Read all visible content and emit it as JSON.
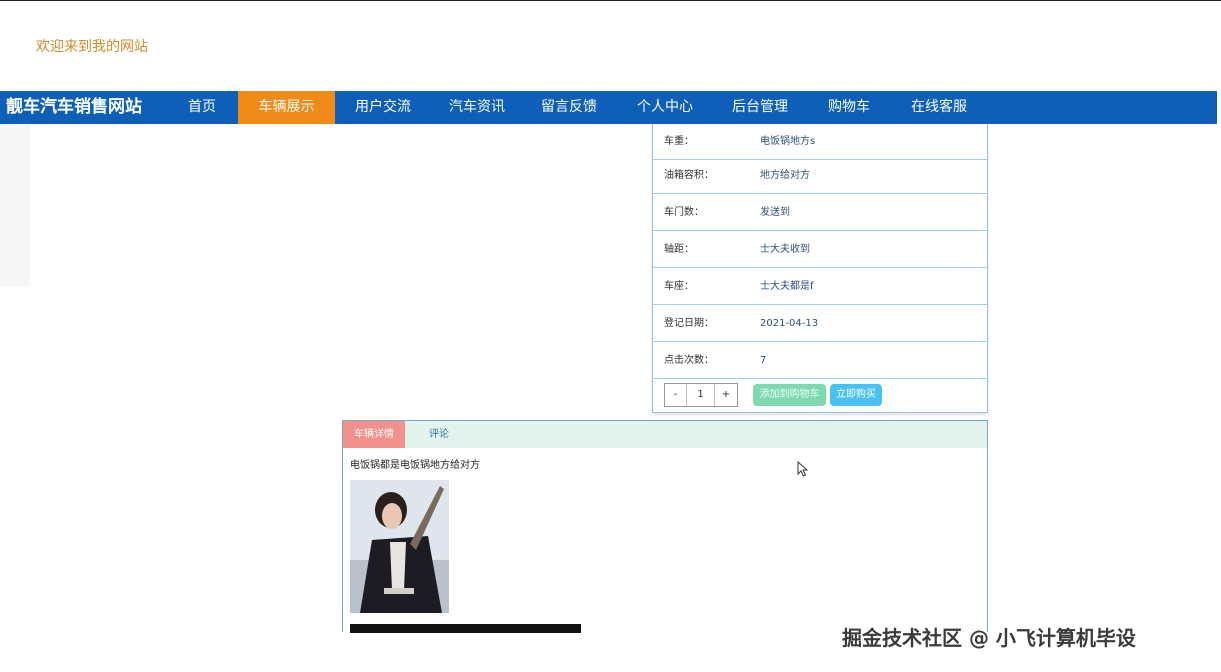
{
  "header": {
    "welcome": "欢迎来到我的网站"
  },
  "nav": {
    "brand": "靓车汽车销售网站",
    "items": [
      {
        "label": "首页"
      },
      {
        "label": "车辆展示",
        "active": true
      },
      {
        "label": "用户交流"
      },
      {
        "label": "汽车资讯"
      },
      {
        "label": "留言反馈"
      },
      {
        "label": "个人中心"
      },
      {
        "label": "后台管理"
      },
      {
        "label": "购物车"
      },
      {
        "label": "在线客服"
      }
    ]
  },
  "detail": {
    "rows": [
      {
        "label": "车重：",
        "value": "电饭锅地方s"
      },
      {
        "label": "油箱容积：",
        "value": "地方给对方"
      },
      {
        "label": "车门数：",
        "value": "发送到"
      },
      {
        "label": "轴距：",
        "value": "士大夫收到"
      },
      {
        "label": "车座：",
        "value": "士大夫都是f"
      },
      {
        "label": "登记日期：",
        "value": "2021-04-13"
      },
      {
        "label": "点击次数：",
        "value": "7"
      }
    ],
    "quantity": {
      "minus": "-",
      "value": "1",
      "plus": "+"
    },
    "add_to_cart": "添加到购物车",
    "buy_now": "立即购买"
  },
  "tabs": {
    "items": [
      {
        "label": "车辆详情",
        "active": true
      },
      {
        "label": "评论"
      }
    ],
    "description": "电饭锅都是电饭锅地方给对方"
  },
  "watermark": "掘金技术社区 @ 小飞计算机毕设",
  "colors": {
    "nav_bg": "#0d5fb8",
    "nav_active": "#f08b18",
    "welcome": "#d08c2c",
    "cart_button": "#7fd9b0",
    "buy_button": "#48c2f2",
    "tab_active": "#f2908b"
  }
}
